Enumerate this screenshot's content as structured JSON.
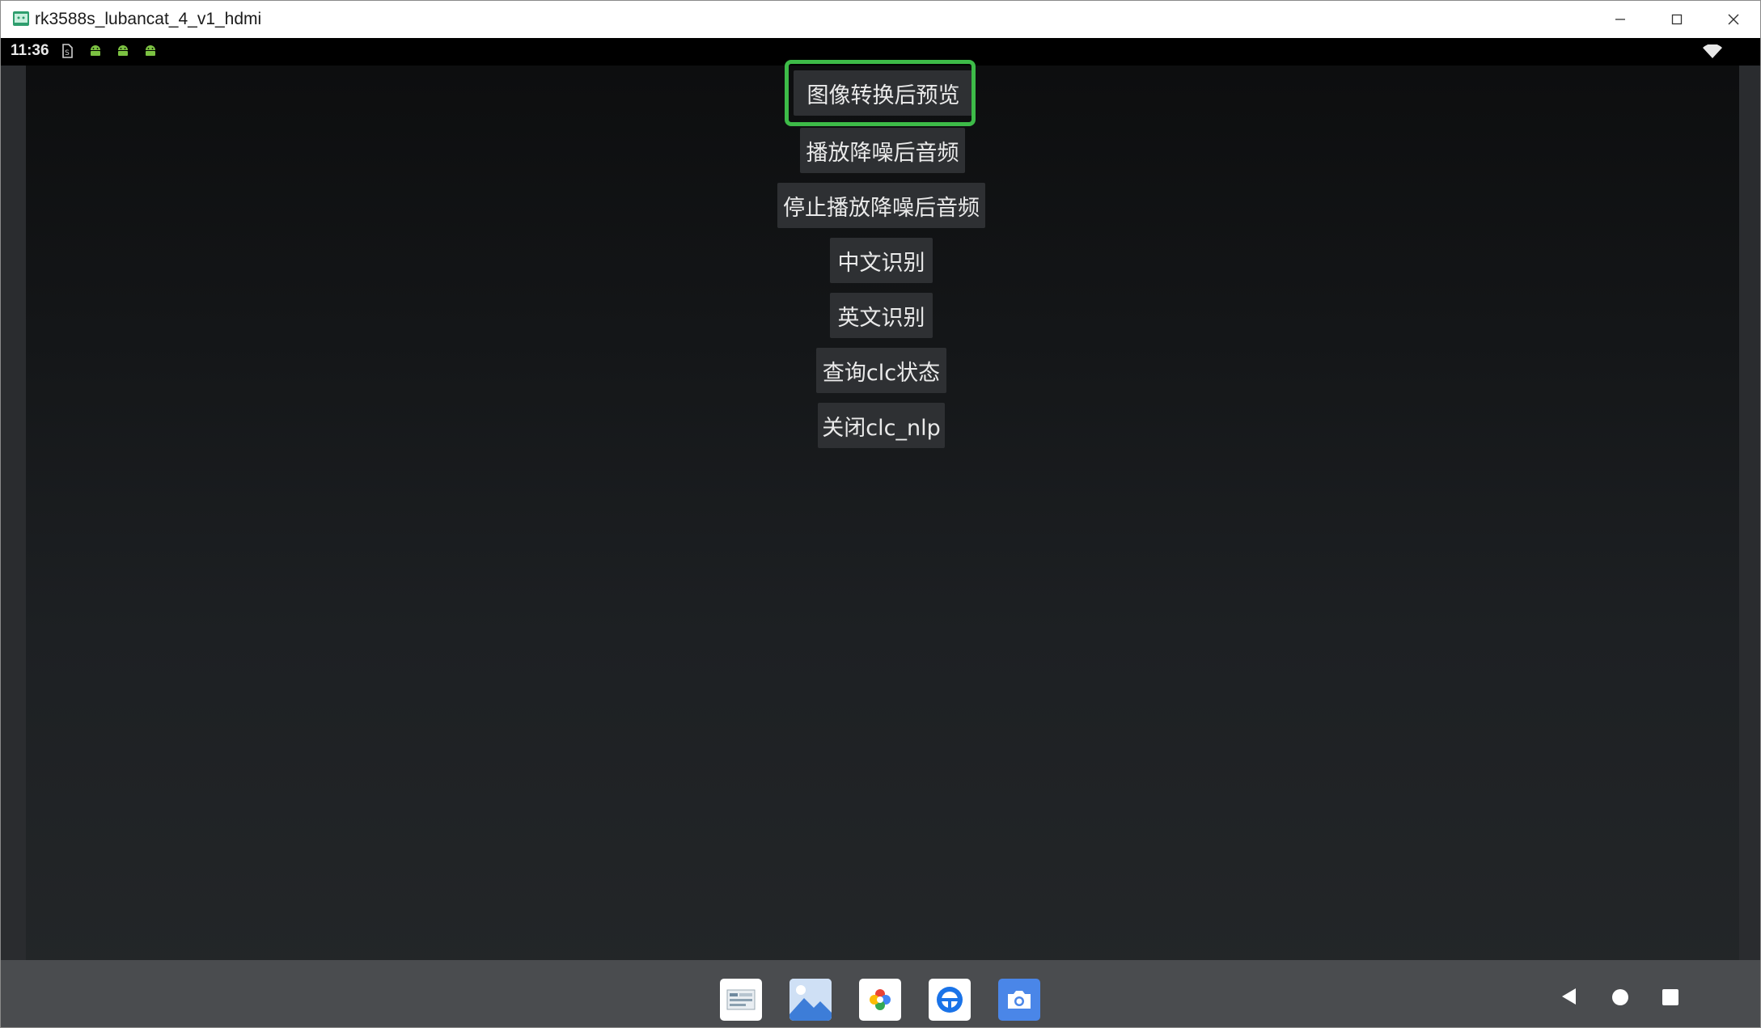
{
  "window": {
    "title": "rk3588s_lubancat_4_v1_hdmi",
    "app_icon": "android-studio-emulator-icon",
    "controls": [
      "minimize-icon",
      "maximize-icon",
      "close-icon"
    ]
  },
  "statusbar": {
    "time": "11:36",
    "icons": [
      "sim-icon",
      "android-icon",
      "android-icon",
      "android-icon",
      "wifi-icon"
    ]
  },
  "buttons": {
    "preview": "图像转换后预览",
    "play": "播放降噪后音频",
    "stop": "停止播放降噪后音频",
    "zh_recognition": "中文识别",
    "en_recognition": "英文识别",
    "query_status": "查询clc状态",
    "close_nlp": "关闭clc_nlp"
  },
  "highlight": {
    "target": "preview",
    "color": "#3dbb48"
  },
  "dock": {
    "apps": [
      "files-icon",
      "gallery-icon",
      "photos-icon",
      "browser-icon",
      "camera-icon"
    ]
  },
  "navigation": [
    "back-icon",
    "home-icon",
    "recents-icon"
  ],
  "colors": {
    "button_bg": "#2e3033",
    "button_text": "#eaeaea",
    "navbar_bg": "#4a4c4f",
    "statusbar_bg": "#000000",
    "highlight": "#3dbb48"
  }
}
